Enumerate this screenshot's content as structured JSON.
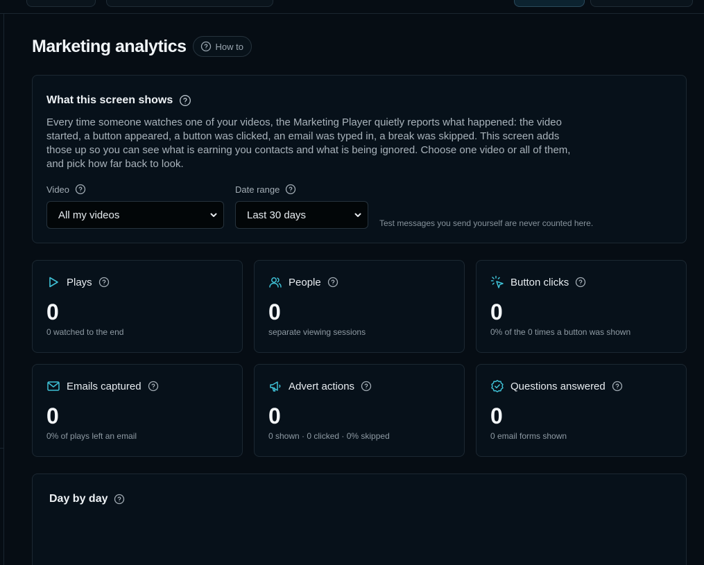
{
  "header": {
    "title": "Marketing analytics",
    "howto_label": "How to"
  },
  "info": {
    "title": "What this screen shows",
    "body": "Every time someone watches one of your videos, the Marketing Player quietly reports what happened: the video started, a button appeared, a button was clicked, an email was typed in, a break was skipped. This screen adds those up so you can see what is earning you contacts and what is being ignored. Choose one video or all of them, and pick how far back to look.",
    "video_label": "Video",
    "video_value": "All my videos",
    "range_label": "Date range",
    "range_value": "Last 30 days",
    "note": "Test messages you send yourself are never counted here."
  },
  "stats": [
    {
      "label": "Plays",
      "value": "0",
      "sub": "0 watched to the end",
      "icon": "play-icon"
    },
    {
      "label": "People",
      "value": "0",
      "sub": "separate viewing sessions",
      "icon": "people-icon"
    },
    {
      "label": "Button clicks",
      "value": "0",
      "sub": "0% of the 0 times a button was shown",
      "icon": "cursor-click-icon"
    },
    {
      "label": "Emails captured",
      "value": "0",
      "sub": "0% of plays left an email",
      "icon": "mail-icon"
    },
    {
      "label": "Advert actions",
      "value": "0",
      "sub": "0 shown · 0 clicked · 0% skipped",
      "icon": "megaphone-icon"
    },
    {
      "label": "Questions answered",
      "value": "0",
      "sub": "0 email forms shown",
      "icon": "check-badge-icon"
    }
  ],
  "day": {
    "title": "Day by day"
  },
  "colors": {
    "accent": "#3fc1d6",
    "background": "#060d14",
    "card": "#07111a"
  }
}
